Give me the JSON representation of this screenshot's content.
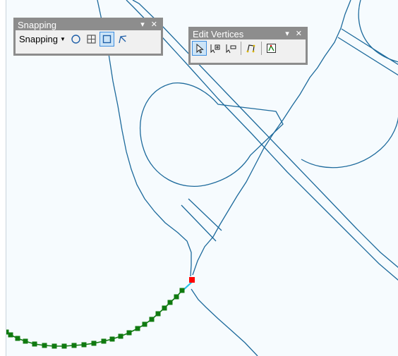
{
  "snapping_toolbar": {
    "title": "Snapping",
    "controls": "▾ ✕",
    "dropdown_label": "Snapping",
    "dropdown_caret": "▼",
    "buttons": [
      "point-snap-icon",
      "end-snap-icon",
      "vertex-snap-icon",
      "edge-snap-icon"
    ]
  },
  "edit_vertices_toolbar": {
    "title": "Edit Vertices",
    "controls": "▾ ✕",
    "buttons": [
      "modify-sketch-vertices-icon",
      "add-vertex-icon",
      "delete-vertex-icon",
      "continue-feature-icon",
      "sketch-properties-icon"
    ]
  },
  "colors": {
    "map_background": "#f6fbfe",
    "road_line": "#1d6a9c",
    "vertex_marker": "#107a10",
    "selected_vertex": "#ff0000",
    "active_segment": "#27c2e8",
    "toolbar_title_bg": "#8d8d8d",
    "button_active_fill": "#cce4f7"
  }
}
